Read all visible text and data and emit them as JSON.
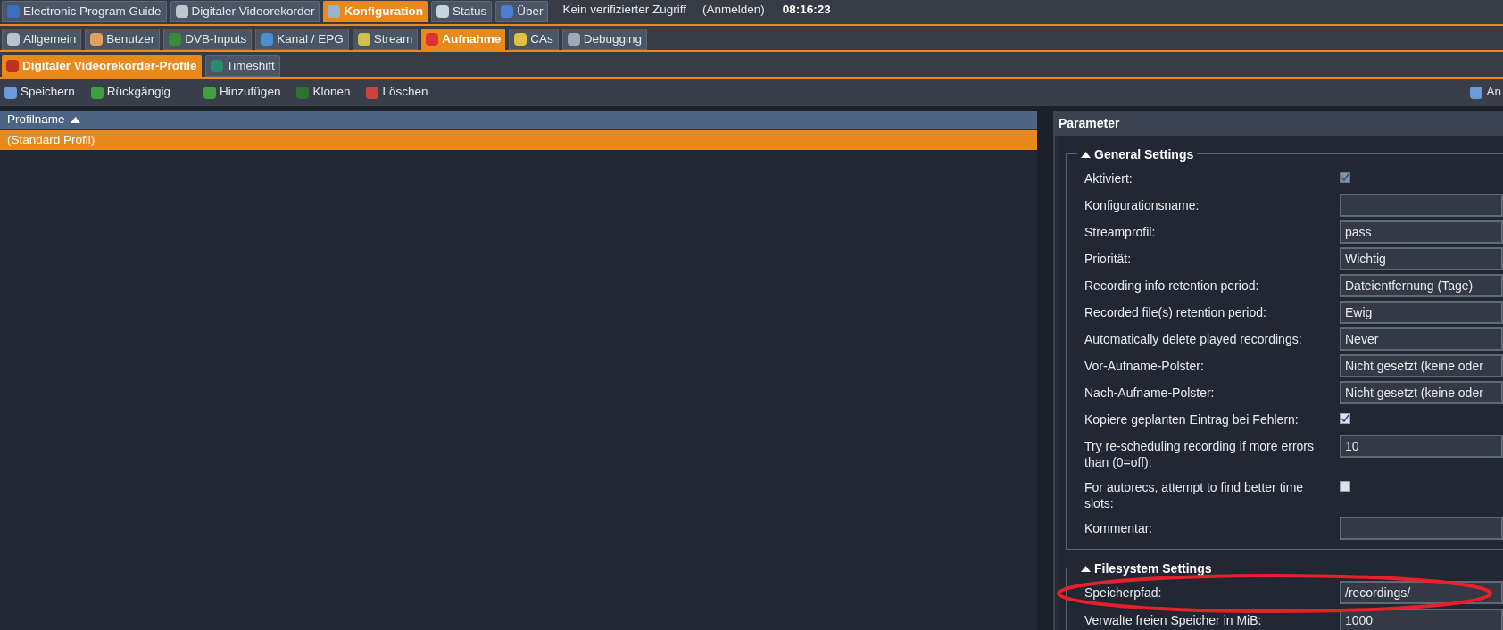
{
  "main_tabs": [
    {
      "label": "Electronic Program Guide",
      "selected": false
    },
    {
      "label": "Digitaler Videorekorder",
      "selected": false
    },
    {
      "label": "Konfiguration",
      "selected": true
    },
    {
      "label": "Status",
      "selected": false
    },
    {
      "label": "Über",
      "selected": false
    }
  ],
  "access_status": "Kein verifizierter Zugriff",
  "login_link": "(Anmelden)",
  "clock": "08:16:23",
  "config_tabs": [
    {
      "label": "Allgemein",
      "selected": false
    },
    {
      "label": "Benutzer",
      "selected": false
    },
    {
      "label": "DVB-Inputs",
      "selected": false
    },
    {
      "label": "Kanal / EPG",
      "selected": false
    },
    {
      "label": "Stream",
      "selected": false
    },
    {
      "label": "Aufnahme",
      "selected": true
    },
    {
      "label": "CAs",
      "selected": false
    },
    {
      "label": "Debugging",
      "selected": false
    }
  ],
  "recording_tabs": [
    {
      "label": "Digitaler Videorekorder-Profile",
      "selected": true
    },
    {
      "label": "Timeshift",
      "selected": false
    }
  ],
  "toolbar": {
    "buttons": [
      {
        "label": "Speichern"
      },
      {
        "label": "Rückgängig"
      },
      {
        "label": "Hinzufügen"
      },
      {
        "label": "Klonen"
      },
      {
        "label": "Löschen"
      }
    ],
    "right_button": "An"
  },
  "table": {
    "columns": [
      {
        "label": "Profilname",
        "sorted_ascending": true
      }
    ],
    "rows": [
      {
        "cells": [
          "(Standard Profil)"
        ],
        "selected": true
      }
    ]
  },
  "parameter_panel": {
    "title": "Parameter",
    "sections": [
      {
        "title": "General Settings",
        "expanded": true,
        "fields": [
          {
            "kind": "checkbox",
            "label": "Aktiviert:",
            "checked": true,
            "disabled": true
          },
          {
            "kind": "text",
            "label": "Konfigurationsname:"
          },
          {
            "kind": "text",
            "label": "Streamprofil:",
            "value": "pass"
          },
          {
            "kind": "text",
            "label": "Priorität:",
            "value": "Wichtig"
          },
          {
            "kind": "text",
            "label": "Recording info retention period:",
            "value": "Dateientfernung (Tage)"
          },
          {
            "kind": "text",
            "label": "Recorded file(s) retention period:",
            "value": "Ewig"
          },
          {
            "kind": "text",
            "label": "Automatically delete played recordings:",
            "value": "Never"
          },
          {
            "kind": "text",
            "label": "Vor-Aufname-Polster:",
            "value": "Nicht gesetzt (keine oder"
          },
          {
            "kind": "text",
            "label": "Nach-Aufname-Polster:",
            "value": "Nicht gesetzt (keine oder"
          },
          {
            "kind": "checkbox",
            "label": "Kopiere geplanten Eintrag bei Fehlern:",
            "checked": true,
            "disabled": false
          },
          {
            "kind": "text",
            "label": "Try re-scheduling recording if more errors than (0=off):",
            "value": "10"
          },
          {
            "kind": "checkbox",
            "label": "For autorecs, attempt to find better time slots:",
            "checked": false,
            "disabled": false
          },
          {
            "kind": "text",
            "label": "Kommentar:"
          }
        ]
      },
      {
        "title": "Filesystem Settings",
        "expanded": true,
        "fields": [
          {
            "kind": "text",
            "label": "Speicherpfad:",
            "value": "/recordings/"
          },
          {
            "kind": "text",
            "label": "Verwalte freien Speicher in MiB:",
            "value": "1000"
          }
        ]
      }
    ]
  }
}
